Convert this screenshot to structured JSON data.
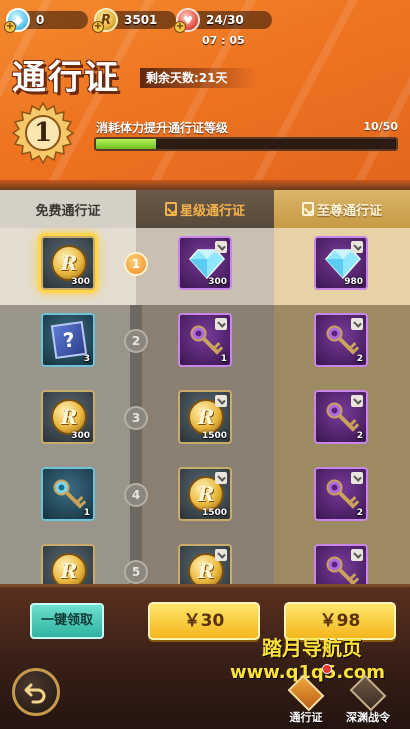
{
  "resources": {
    "diamond": {
      "value": "0",
      "icon": "diamond-icon"
    },
    "coin": {
      "value": "3501",
      "icon": "coin-icon",
      "glyph": "R"
    },
    "stamina": {
      "value": "24/30",
      "icon": "stamina-icon"
    },
    "timer": "07 : 05"
  },
  "header": {
    "title": "通行证",
    "remaining": "剩余天数:21天",
    "level": "1",
    "exp_label": "消耗体力提升通行证等级",
    "exp_count": "10/50",
    "exp_progress": 0.2
  },
  "tiers": {
    "free": "免费通行证",
    "star": "星级通行证",
    "supreme": "至尊通行证"
  },
  "rows": [
    {
      "level": "1",
      "active": true,
      "free": {
        "kind": "coin",
        "qty": "300",
        "selected": true
      },
      "star": {
        "kind": "diamond",
        "qty": "300"
      },
      "supreme": {
        "kind": "diamond",
        "qty": "980"
      }
    },
    {
      "level": "2",
      "active": false,
      "free": {
        "kind": "mystery",
        "qty": "3"
      },
      "star": {
        "kind": "key-purple",
        "qty": "1"
      },
      "supreme": {
        "kind": "key-purple",
        "qty": "2"
      }
    },
    {
      "level": "3",
      "active": false,
      "free": {
        "kind": "coin",
        "qty": "300"
      },
      "star": {
        "kind": "coin",
        "qty": "1500"
      },
      "supreme": {
        "kind": "key-purple",
        "qty": "2"
      }
    },
    {
      "level": "4",
      "active": false,
      "free": {
        "kind": "key-blue",
        "qty": "1"
      },
      "star": {
        "kind": "coin",
        "qty": "1500"
      },
      "supreme": {
        "kind": "key-purple",
        "qty": "2"
      }
    },
    {
      "level": "5",
      "active": false,
      "free": {
        "kind": "coin",
        "qty": ""
      },
      "star": {
        "kind": "coin",
        "qty": ""
      },
      "supreme": {
        "kind": "key-purple",
        "qty": ""
      }
    }
  ],
  "actions": {
    "claim_all": "一键领取",
    "buy_star": "￥30",
    "buy_supreme": "￥98"
  },
  "watermark": {
    "line1": "踏月导航页",
    "line2": "www.q1q5.com"
  },
  "nav": {
    "pass": "通行证",
    "abyss": "深渊战令"
  },
  "colors": {
    "banner": "#ee7422",
    "exp_fill": "#8fd93a",
    "buy_button": "#f4c02a",
    "claim_button": "#3fc4b1"
  }
}
